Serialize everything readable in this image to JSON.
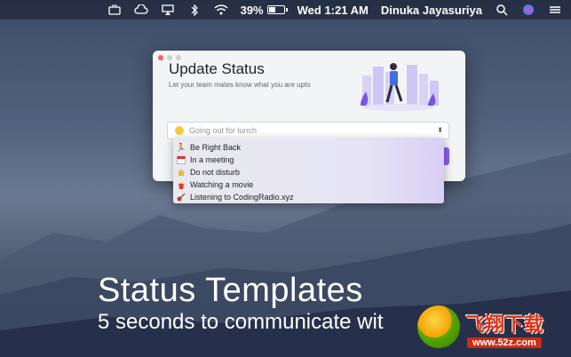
{
  "menubar": {
    "battery_percent": "39%",
    "clock": "Wed 1:21 AM",
    "user": "Dinuka Jayasuriya",
    "icons": [
      "briefcase-icon",
      "creative-cloud-icon",
      "airplay-icon",
      "bluetooth-icon",
      "wifi-icon",
      "battery-icon",
      "search-icon",
      "siri-icon",
      "control-center-icon"
    ]
  },
  "window": {
    "title": "Update Status",
    "subtitle": "Let your team mates know what you are upto",
    "status_select": {
      "placeholder": "Going out for lunch"
    }
  },
  "dropdown": {
    "items": [
      {
        "icon": "running-person-icon",
        "label": "Be Right Back"
      },
      {
        "icon": "calendar-icon",
        "label": "In a meeting"
      },
      {
        "icon": "hand-icon",
        "label": "Do not disturb"
      },
      {
        "icon": "popcorn-icon",
        "label": "Watching a movie"
      },
      {
        "icon": "guitar-icon",
        "label": "Listening to CodingRadio.xyz"
      }
    ]
  },
  "hero": {
    "title": "Status Templates",
    "subtitle": "5 seconds to communicate wit"
  },
  "watermark": {
    "brand": "飞翔下载",
    "url": "www.52z.com"
  },
  "colors": {
    "accent_purple": "#8a5cf5",
    "close_red": "#ff5f57",
    "watermark_red": "#d02a10"
  }
}
